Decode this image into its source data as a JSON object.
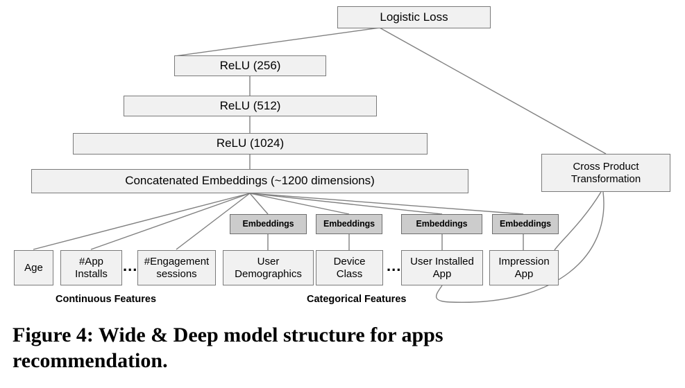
{
  "figure": {
    "caption_line1": "Figure 4:  Wide &amp; Deep model structure for apps",
    "caption_line2": "recommendation.",
    "caption_full": "Figure 4: Wide & Deep model structure for apps recommendation."
  },
  "colors": {
    "box_fill": "#f1f1f1",
    "box_border": "#7a7a7a",
    "embedding_fill": "#cccccc",
    "embedding_border": "#6e6e6e",
    "wire": "#808080",
    "text": "#000000",
    "background": "#ffffff"
  },
  "nodes": {
    "loss": {
      "label": "Logistic Loss"
    },
    "relu256": {
      "label": "ReLU (256)"
    },
    "relu512": {
      "label": "ReLU (512)"
    },
    "relu1024": {
      "label": "ReLU (1024)"
    },
    "concat": {
      "label": "Concatenated Embeddings (~1200 dimensions)"
    },
    "cross": {
      "label_line1": "Cross Product",
      "label_line2": "Transformation"
    }
  },
  "embeddings": [
    {
      "id": "emb-user-demographics",
      "label": "Embeddings"
    },
    {
      "id": "emb-device-class",
      "label": "Embeddings"
    },
    {
      "id": "emb-user-installed-app",
      "label": "Embeddings"
    },
    {
      "id": "emb-impression-app",
      "label": "Embeddings"
    }
  ],
  "features": {
    "continuous": {
      "group_label": "Continuous Features",
      "items": [
        {
          "id": "feature-age",
          "label": "Age"
        },
        {
          "id": "feature-app-installs",
          "label_line1": "#App",
          "label_line2": "Installs"
        },
        {
          "id": "feature-engagement-sessions",
          "label_line1": "#Engagement",
          "label_line2": "sessions"
        }
      ],
      "ellipsis": "..."
    },
    "categorical": {
      "group_label": "Categorical Features",
      "items": [
        {
          "id": "feature-user-demographics",
          "label_line1": "User",
          "label_line2": "Demographics"
        },
        {
          "id": "feature-device-class",
          "label_line1": "Device",
          "label_line2": "Class"
        },
        {
          "id": "feature-user-installed-app",
          "label_line1": "User Installed",
          "label_line2": "App"
        },
        {
          "id": "feature-impression-app",
          "label_line1": "Impression",
          "label_line2": "App"
        }
      ],
      "ellipsis": "..."
    }
  }
}
